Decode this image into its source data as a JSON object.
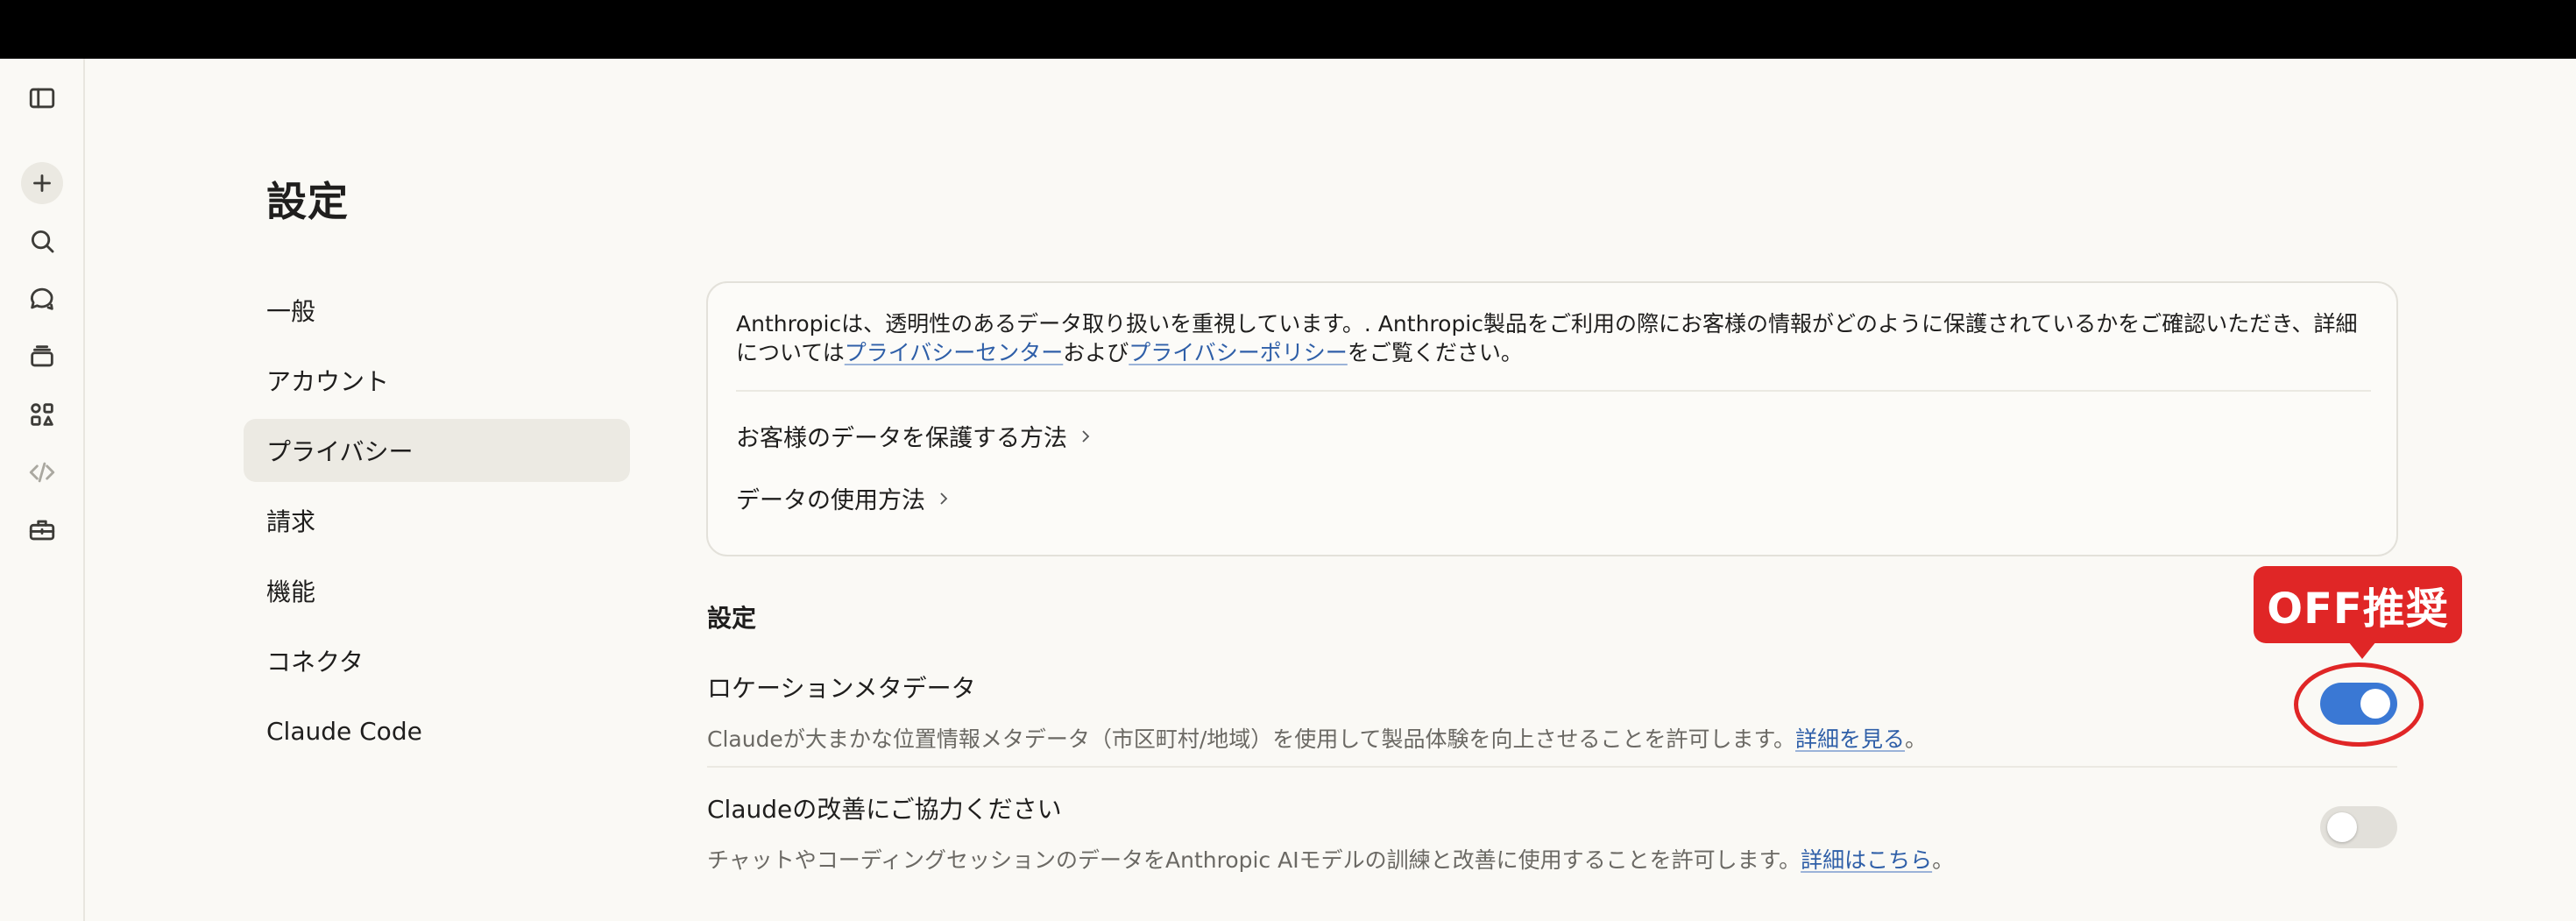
{
  "page": {
    "title": "設定"
  },
  "rail": {
    "icons": [
      "sidebar-toggle-icon",
      "plus-icon",
      "search-icon",
      "chats-icon",
      "projects-icon",
      "artifacts-icon",
      "code-icon",
      "toolbox-icon"
    ]
  },
  "nav": {
    "items": [
      {
        "label": "一般"
      },
      {
        "label": "アカウント"
      },
      {
        "label": "プライバシー"
      },
      {
        "label": "請求"
      },
      {
        "label": "機能"
      },
      {
        "label": "コネクタ"
      },
      {
        "label": "Claude Code"
      }
    ],
    "active_index": 2
  },
  "privacy_card": {
    "text_part1": "Anthropicは、透明性のあるデータ取り扱いを重視しています。. Anthropic製品をご利用の際にお客様の情報がどのように保護されているかをご確認いただき、詳細については",
    "link_privacy_center": "プライバシーセンター",
    "text_part2": "および",
    "link_privacy_policy": "プライバシーポリシー",
    "text_part3": "をご覧ください。",
    "link_protect_data": "お客様のデータを保護する方法",
    "link_data_usage": "データの使用方法"
  },
  "settings": {
    "section_title": "設定",
    "location": {
      "title": "ロケーションメタデータ",
      "desc": "Claudeが大まかな位置情報メタデータ（市区町村/地域）を使用して製品体験を向上させることを許可します。",
      "link": "詳細を見る",
      "suffix": "。",
      "enabled": true
    },
    "improve": {
      "title": "Claudeの改善にご協力ください",
      "desc": "チャットやコーディングセッションのデータをAnthropic AIモデルの訓練と改善に使用することを許可します。",
      "link": "詳細はこちら",
      "suffix": "。",
      "enabled": false
    }
  },
  "annotation": {
    "callout": "OFF推奨"
  },
  "colors": {
    "accent": "#3a78d4",
    "annotation_red": "#e02626",
    "background": "#faf9f5",
    "link": "#2f5fa8"
  }
}
